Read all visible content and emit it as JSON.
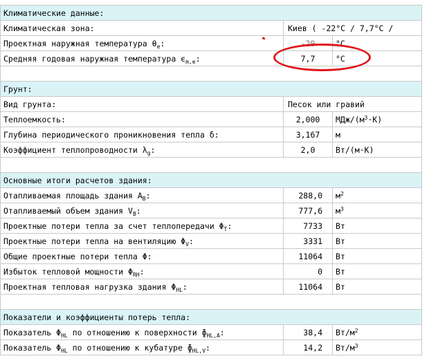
{
  "sections": {
    "climate": "Климатические данные:",
    "soil": "Грунт:",
    "results": "Основные итоги расчетов здания:",
    "indicators": "Показатели и коэффициенты потерь тепла:"
  },
  "climate": {
    "zone_label": "Климатическая зона:",
    "zone_value": "Киев  ( -22°C / 7,7°C /",
    "design_temp_label": "Проектная наружная температура θ",
    "design_temp_sub": "e",
    "design_temp_value": "-20",
    "design_temp_unit": "°C",
    "annual_temp_label": "Средняя годовая наружная температура ϵ",
    "annual_temp_sub": "m,e",
    "annual_temp_value": "7,7",
    "annual_temp_unit": "°C"
  },
  "soil": {
    "type_label": "Вид грунта:",
    "type_value": "Песок или гравий",
    "capacity_label": "Теплоемкость:",
    "capacity_value": "2,000",
    "capacity_unit": "МДж/(м",
    "capacity_unit_sup": "3",
    "capacity_unit_end": "·K)",
    "depth_label": "Глубина периодического проникновения тепла δ:",
    "depth_value": "3,167",
    "depth_unit": "м",
    "conductivity_label": "Коэффициент теплопроводности λ",
    "conductivity_sub": "g",
    "conductivity_value": "2,0",
    "conductivity_unit": "Вт/(м·K)"
  },
  "results": {
    "area_label": "Отапливаемая площадь здания A",
    "area_sub": "B",
    "area_value": "288,0",
    "area_unit": "м",
    "area_unit_sup": "2",
    "volume_label": "Отапливаемый объем здания V",
    "volume_sub": "B",
    "volume_value": "777,6",
    "volume_unit": "м",
    "volume_unit_sup": "3",
    "transmission_label": "Проектные потери тепла за счет теплопередачи Φ",
    "transmission_sub": "T",
    "transmission_value": "7733",
    "transmission_unit": "Вт",
    "ventilation_label": "Проектные потери тепла на вентиляцию Φ",
    "ventilation_sub": "V",
    "ventilation_value": "3331",
    "ventilation_unit": "Вт",
    "total_label": "Общие проектные потери тепла Φ:",
    "total_value": "11064",
    "total_unit": "Вт",
    "excess_label": "Избыток тепловой мощности Φ",
    "excess_sub": "RH",
    "excess_value": "0",
    "excess_unit": "Вт",
    "load_label": "Проектная тепловая нагрузка здания Φ",
    "load_sub": "HL",
    "load_value": "11064",
    "load_unit": "Вт"
  },
  "indicators": {
    "surface_label_a": "Показатель Φ",
    "surface_sub_a": "HL",
    "surface_label_b": " по отношению к поверхности ɸ",
    "surface_sub_b": "HL,A",
    "surface_value": "38,4",
    "surface_unit": "Вт/м",
    "surface_unit_sup": "2",
    "volume_label_a": "Показатель Φ",
    "volume_sub_a": "HL",
    "volume_label_b": " по отношению к кубатуре ɸ",
    "volume_sub_b": "HL,V",
    "volume_value": "14,2",
    "volume_unit": "Вт/м",
    "volume_unit_sup": "3"
  },
  "colors": {
    "section_bg": "#d9f3f7",
    "grid": "#c9c9c9",
    "highlight": "#e0141c"
  }
}
